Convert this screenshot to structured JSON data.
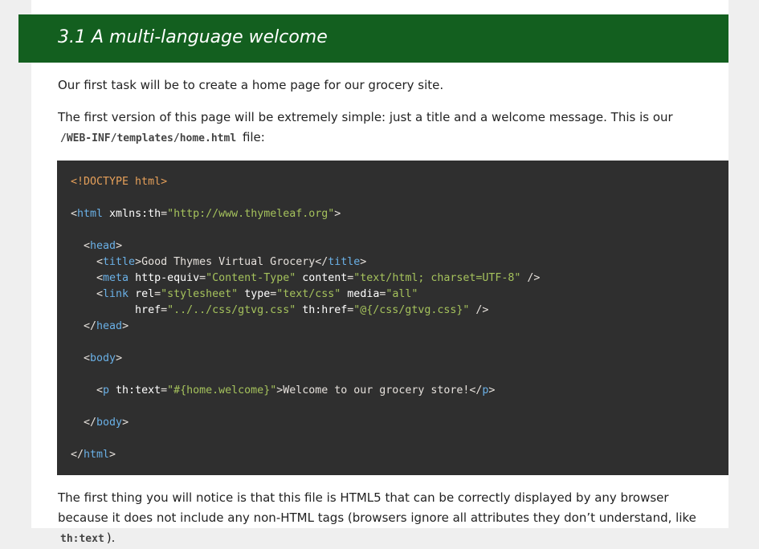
{
  "header": {
    "title": "3.1 A multi-language welcome"
  },
  "para1": "Our first task will be to create a home page for our grocery site.",
  "para2": {
    "before": "The first version of this page will be extremely simple: just a title and a welcome message. This is our",
    "code": "/WEB-INF/templates/home.html",
    "after": "file:"
  },
  "para3": {
    "before": "The first thing you will notice is that this file is HTML5 that can be correctly displayed by any browser because it does not include any non-HTML tags (browsers ignore all attributes they don’t understand, like",
    "code": "th:text",
    "after": ")."
  },
  "code_lines": [
    [
      [
        "dt",
        "<!DOCTYPE html>"
      ]
    ],
    [],
    [
      [
        "br",
        "<"
      ],
      [
        "tag",
        "html"
      ],
      [
        "attr",
        " xmlns:th"
      ],
      [
        "br",
        "="
      ],
      [
        "val",
        "\"http://www.thymeleaf.org\""
      ],
      [
        "br",
        ">"
      ]
    ],
    [],
    [
      [
        "br",
        "  <"
      ],
      [
        "tag",
        "head"
      ],
      [
        "br",
        ">"
      ]
    ],
    [
      [
        "br",
        "    <"
      ],
      [
        "tag",
        "title"
      ],
      [
        "br",
        ">"
      ],
      [
        "txt",
        "Good Thymes Virtual Grocery"
      ],
      [
        "br",
        "</"
      ],
      [
        "tag",
        "title"
      ],
      [
        "br",
        ">"
      ]
    ],
    [
      [
        "br",
        "    <"
      ],
      [
        "tag",
        "meta"
      ],
      [
        "attr",
        " http-equiv"
      ],
      [
        "br",
        "="
      ],
      [
        "val",
        "\"Content-Type\""
      ],
      [
        "attr",
        " content"
      ],
      [
        "br",
        "="
      ],
      [
        "val",
        "\"text/html; charset=UTF-8\""
      ],
      [
        "br",
        " />"
      ]
    ],
    [
      [
        "br",
        "    <"
      ],
      [
        "tag",
        "link"
      ],
      [
        "attr",
        " rel"
      ],
      [
        "br",
        "="
      ],
      [
        "val",
        "\"stylesheet\""
      ],
      [
        "attr",
        " type"
      ],
      [
        "br",
        "="
      ],
      [
        "val",
        "\"text/css\""
      ],
      [
        "attr",
        " media"
      ],
      [
        "br",
        "="
      ],
      [
        "val",
        "\"all\""
      ]
    ],
    [
      [
        "attr",
        "          href"
      ],
      [
        "br",
        "="
      ],
      [
        "val",
        "\"../../css/gtvg.css\""
      ],
      [
        "attr",
        " th:href"
      ],
      [
        "br",
        "="
      ],
      [
        "val",
        "\"@{/css/gtvg.css}\""
      ],
      [
        "br",
        " />"
      ]
    ],
    [
      [
        "br",
        "  </"
      ],
      [
        "tag",
        "head"
      ],
      [
        "br",
        ">"
      ]
    ],
    [],
    [
      [
        "br",
        "  <"
      ],
      [
        "tag",
        "body"
      ],
      [
        "br",
        ">"
      ]
    ],
    [],
    [
      [
        "br",
        "    <"
      ],
      [
        "tag",
        "p"
      ],
      [
        "attr",
        " th:text"
      ],
      [
        "br",
        "="
      ],
      [
        "val",
        "\"#{home.welcome}\""
      ],
      [
        "br",
        ">"
      ],
      [
        "txt",
        "Welcome to our grocery store!"
      ],
      [
        "br",
        "</"
      ],
      [
        "tag",
        "p"
      ],
      [
        "br",
        ">"
      ]
    ],
    [],
    [
      [
        "br",
        "  </"
      ],
      [
        "tag",
        "body"
      ],
      [
        "br",
        ">"
      ]
    ],
    [],
    [
      [
        "br",
        "</"
      ],
      [
        "tag",
        "html"
      ],
      [
        "br",
        ">"
      ]
    ]
  ],
  "colors": {
    "header_bg": "#135f1f",
    "code_bg": "#2f2f2f",
    "tag": "#6ab0e6",
    "value": "#a5c25c",
    "doctype": "#e6a05a"
  }
}
